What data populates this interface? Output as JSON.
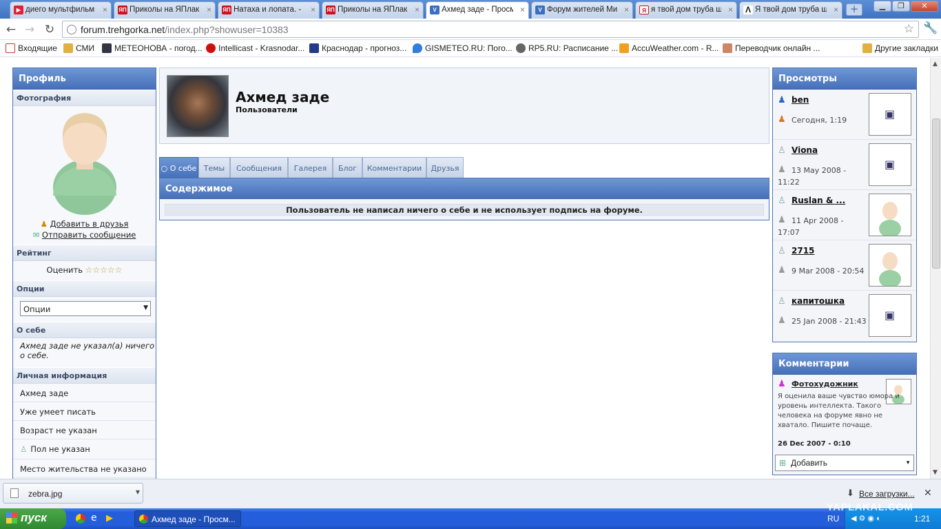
{
  "browser": {
    "tabs": [
      {
        "label": "диего мультфильм н",
        "color": "#d23"
      },
      {
        "label": "Приколы на ЯПлакаЛ",
        "color": "#c12"
      },
      {
        "label": "Натаха и лопата. - Г",
        "color": "#c12"
      },
      {
        "label": "Приколы на ЯПлака",
        "color": "#c12"
      },
      {
        "label": "Ахмед заде - Просм",
        "color": "#3b6fc0"
      },
      {
        "label": "Форум жителей Мик",
        "color": "#3b6fc0"
      },
      {
        "label": "я твой дом труба ш",
        "color": "#c12"
      },
      {
        "label": "Я твой дом труба ш",
        "color": "#222"
      }
    ],
    "new_tab_symbol": "+",
    "window_controls": {
      "minimize": "▁",
      "maximize": "❐",
      "close": "✕"
    },
    "url_host": "forum.trehgorka.net",
    "url_rest": "/index.php?showuser=10383",
    "bookmarks": [
      {
        "label": "Входящие",
        "color": "#c33"
      },
      {
        "label": "СМИ",
        "color": "#e0b040"
      },
      {
        "label": "МЕТЕОНОВА - погод...",
        "color": "#334"
      },
      {
        "label": "Intellicast - Krasnodar...",
        "color": "#c11"
      },
      {
        "label": "Краснодар - прогноз...",
        "color": "#223a88"
      },
      {
        "label": "GISMETEO.RU: Пого...",
        "color": "#2f7fe0"
      },
      {
        "label": "RP5.RU: Расписание ...",
        "color": "#666"
      },
      {
        "label": "AccuWeather.com - R...",
        "color": "#f0a020"
      },
      {
        "label": "Переводчик онлайн ...",
        "color": "#c86"
      }
    ],
    "other_bookmarks": "Другие закладки"
  },
  "profile_panel": {
    "title": "Профиль",
    "photo_label": "Фотография",
    "add_friend": "Добавить в друзья",
    "send_message": "Отправить сообщение",
    "rating_label": "Рейтинг",
    "rate_text": "Оценить",
    "stars": "☆☆☆☆☆",
    "options_label": "Опции",
    "options_select": "Опции",
    "about_label": "О себе",
    "about_text": "Ахмед заде не указал(а) ничего о себе.",
    "personal_label": "Личная информация",
    "personal_rows": [
      "Ахмед заде",
      "Уже умеет писать",
      "Возраст не указан",
      "Пол не указан",
      "Место жительства не указано"
    ]
  },
  "user": {
    "name": "Ахмед заде",
    "group": "Пользователи"
  },
  "profile_tabs": [
    "О себе",
    "Темы",
    "Сообщения",
    "Галерея",
    "Блог",
    "Комментарии",
    "Друзья"
  ],
  "content": {
    "title": "Содержимое",
    "message": "Пользователь не написал ничего о себе и не использует подпись на форуме."
  },
  "views": {
    "title": "Просмотры",
    "items": [
      {
        "name": "ben",
        "date": "Сегодня, 1:19"
      },
      {
        "name": "Viona",
        "date": "13 May 2008 - 11:22"
      },
      {
        "name": "Ruslan & ...",
        "date": "11 Apr 2008 - 17:07"
      },
      {
        "name": "2715",
        "date": "9 Mar 2008 - 20:54"
      },
      {
        "name": "капитошка",
        "date": "25 Jan 2008 - 21:43"
      }
    ]
  },
  "comments": {
    "title": "Комментарии",
    "author": "Фотохудожник",
    "text": "Я оценила ваше чувство юмора и уровень интеллекта. Такого человека на форуме явно не хватало. Пишите почаще.",
    "date": "26 Dec 2007 - 0:10",
    "add_label": "Добавить"
  },
  "downloads": {
    "file": "zebra.jpg",
    "all": "Все загрузки..."
  },
  "taskbar": {
    "start": "пуск",
    "active_window": "Ахмед заде - Просм...",
    "lang": "RU",
    "clock": "1:21",
    "watermark": "YAPLAKAL.COM"
  }
}
